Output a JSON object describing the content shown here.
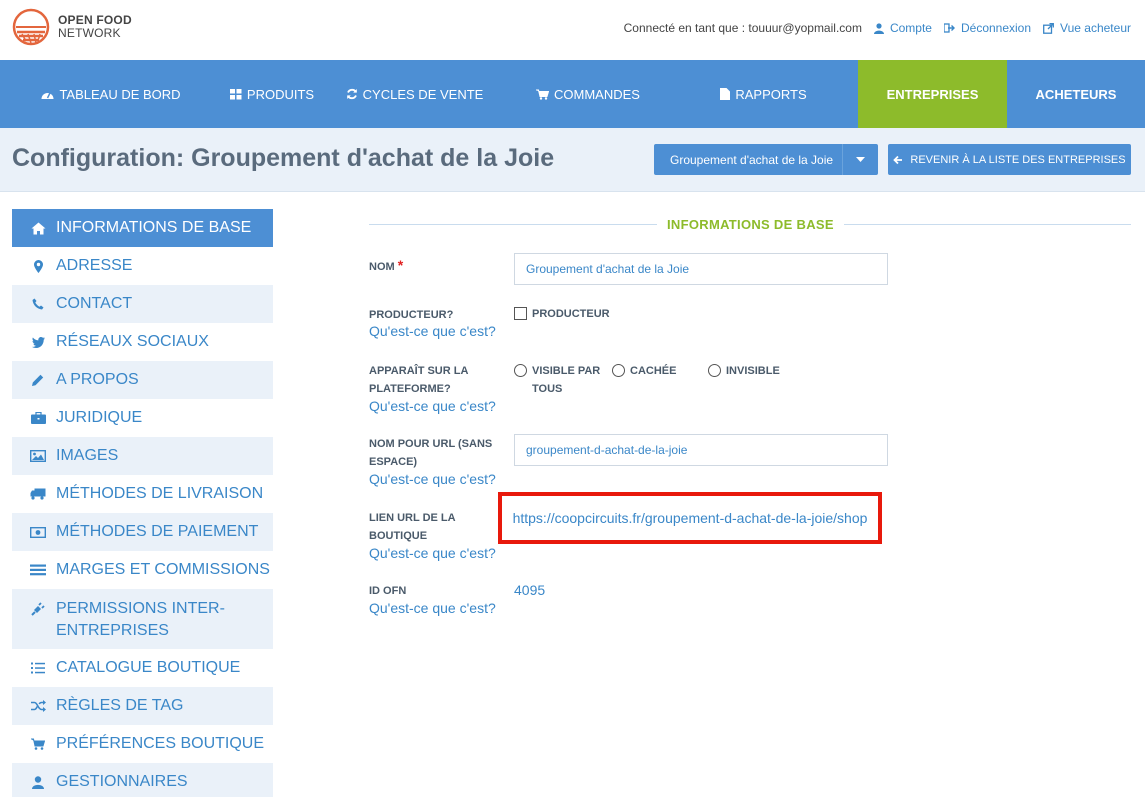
{
  "brand": {
    "line1": "OPEN FOOD",
    "line2": "NETWORK",
    "logo_color": "#e3663d"
  },
  "userbar": {
    "logged_in_text": "Connecté en tant que : touuur@yopmail.com",
    "account_label": "Compte",
    "logout_label": "Déconnexion",
    "shopfront_label": "Vue acheteur"
  },
  "nav": {
    "items": [
      {
        "label": "TABLEAU DE BORD",
        "icon": "dashboard-icon"
      },
      {
        "label": "PRODUITS",
        "icon": "grid-icon"
      },
      {
        "label": "CYCLES DE VENTE",
        "icon": "refresh-icon"
      },
      {
        "label": "COMMANDES",
        "icon": "cart-icon"
      },
      {
        "label": "RAPPORTS",
        "icon": "file-icon"
      },
      {
        "label": "ENTREPRISES",
        "active": true
      },
      {
        "label": "ACHETEURS"
      }
    ],
    "color": "#4d8fd4",
    "active_color": "#8dbb2b"
  },
  "header": {
    "title": "Configuration: Groupement d'achat de la Joie",
    "enterprise_select": "Groupement d'achat de la Joie",
    "back_button": "REVENIR À LA LISTE DES ENTREPRISES"
  },
  "sidebar": {
    "items": [
      {
        "label": "INFORMATIONS DE BASE",
        "icon": "home-icon",
        "active": true
      },
      {
        "label": "ADRESSE",
        "icon": "map-marker-icon"
      },
      {
        "label": "CONTACT",
        "icon": "phone-icon"
      },
      {
        "label": "RÉSEAUX SOCIAUX",
        "icon": "twitter-icon"
      },
      {
        "label": "A PROPOS",
        "icon": "pencil-icon"
      },
      {
        "label": "JURIDIQUE",
        "icon": "briefcase-icon"
      },
      {
        "label": "IMAGES",
        "icon": "image-icon"
      },
      {
        "label": "MÉTHODES DE LIVRAISON",
        "icon": "truck-icon"
      },
      {
        "label": "MÉTHODES DE PAIEMENT",
        "icon": "money-icon"
      },
      {
        "label": "MARGES ET COMMISSIONS",
        "icon": "list-icon"
      },
      {
        "label": "PERMISSIONS INTER-ENTREPRISES",
        "icon": "plug-icon"
      },
      {
        "label": "CATALOGUE BOUTIQUE",
        "icon": "list-ol-icon"
      },
      {
        "label": "RÈGLES DE TAG",
        "icon": "random-icon"
      },
      {
        "label": "PRÉFÉRENCES BOUTIQUE",
        "icon": "cart-icon"
      },
      {
        "label": "GESTIONNAIRES",
        "icon": "user-icon"
      }
    ]
  },
  "form": {
    "section_title": "INFORMATIONS DE BASE",
    "help_text": "Qu'est-ce que c'est?",
    "name": {
      "label": "NOM",
      "required_mark": "*",
      "value": "Groupement d'achat de la Joie"
    },
    "producer": {
      "label": "PRODUCTEUR?",
      "checkbox_label": "PRODUCTEUR",
      "checked": false
    },
    "visibility": {
      "label": "APPARAÎT SUR LA PLATEFORME?",
      "options": [
        "VISIBLE PAR TOUS",
        "CACHÉE",
        "INVISIBLE"
      ]
    },
    "permalink": {
      "label": "NOM POUR URL (SANS ESPACE)",
      "value": "groupement-d-achat-de-la-joie"
    },
    "shop_url": {
      "label": "LIEN URL DE LA BOUTIQUE",
      "value": "https://coopcircuits.fr/groupement-d-achat-de-la-joie/shop",
      "highlight_color": "#e8190c"
    },
    "ofn_id": {
      "label": "ID OFN",
      "value": "4095"
    }
  }
}
